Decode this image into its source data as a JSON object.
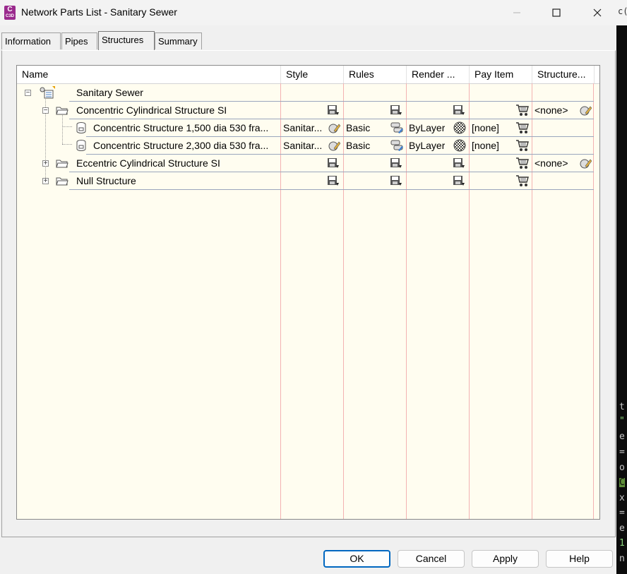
{
  "window": {
    "title": "Network Parts List - Sanitary Sewer",
    "app_icon_text": "C",
    "app_icon_sub": "C3D"
  },
  "tabs": [
    "Information",
    "Pipes",
    "Structures",
    "Summary"
  ],
  "columns": [
    "Name",
    "Style",
    "Rules",
    "Render ...",
    "Pay Item",
    "Structure..."
  ],
  "rows": [
    {
      "name": "Sanitary Sewer",
      "style": "",
      "rules": "",
      "render": "",
      "pay": "",
      "structure": ""
    },
    {
      "name": "Concentric Cylindrical Structure SI",
      "style": "",
      "rules": "",
      "render": "",
      "pay": "",
      "structure": "<none>"
    },
    {
      "name": "Concentric Structure 1,500 dia 530 fra...",
      "style": "Sanitar...",
      "rules": "Basic",
      "render": "ByLayer",
      "pay": "[none]",
      "structure": ""
    },
    {
      "name": "Concentric Structure 2,300 dia 530 fra...",
      "style": "Sanitar...",
      "rules": "Basic",
      "render": "ByLayer",
      "pay": "[none]",
      "structure": ""
    },
    {
      "name": "Eccentric Cylindrical Structure SI",
      "style": "",
      "rules": "",
      "render": "",
      "pay": "",
      "structure": "<none>"
    },
    {
      "name": "Null Structure",
      "style": "",
      "rules": "",
      "render": "",
      "pay": "",
      "structure": ""
    }
  ],
  "buttons": {
    "ok": "OK",
    "cancel": "Cancel",
    "apply": "Apply",
    "help": "Help"
  },
  "terminal": {
    "top": "c(",
    "lines": [
      "t",
      "\"",
      "e",
      "=",
      "o",
      "C",
      "x",
      "=",
      "e",
      "1",
      "n"
    ]
  },
  "colors": {
    "accent": "#0067c0",
    "grid_bg": "#fffdf0",
    "column_line": "#f3b2b2",
    "app_icon": "#9a2a8d"
  }
}
